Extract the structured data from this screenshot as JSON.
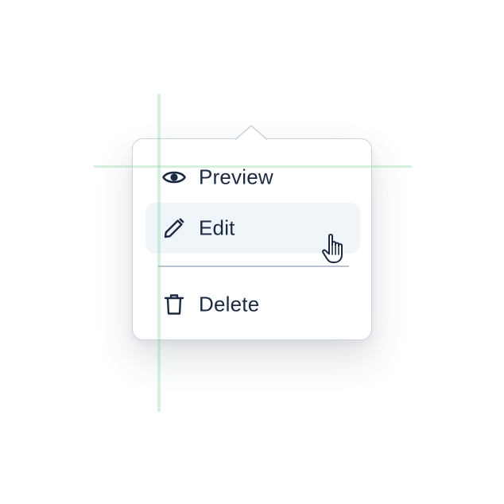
{
  "menu": {
    "items": [
      {
        "id": "preview",
        "label": "Preview",
        "icon": "eye-icon"
      },
      {
        "id": "edit",
        "label": "Edit",
        "icon": "pencil-icon",
        "state": "hovered"
      },
      {
        "id": "delete",
        "label": "Delete",
        "icon": "trash-icon"
      }
    ]
  },
  "colors": {
    "text": "#1b2a44",
    "hover_bg": "#f0f5fa",
    "border": "#c9d3e0",
    "divider": "#b9c3cf",
    "guide": "#86d6a0"
  },
  "cursor": {
    "type": "pointer-hand-icon"
  }
}
